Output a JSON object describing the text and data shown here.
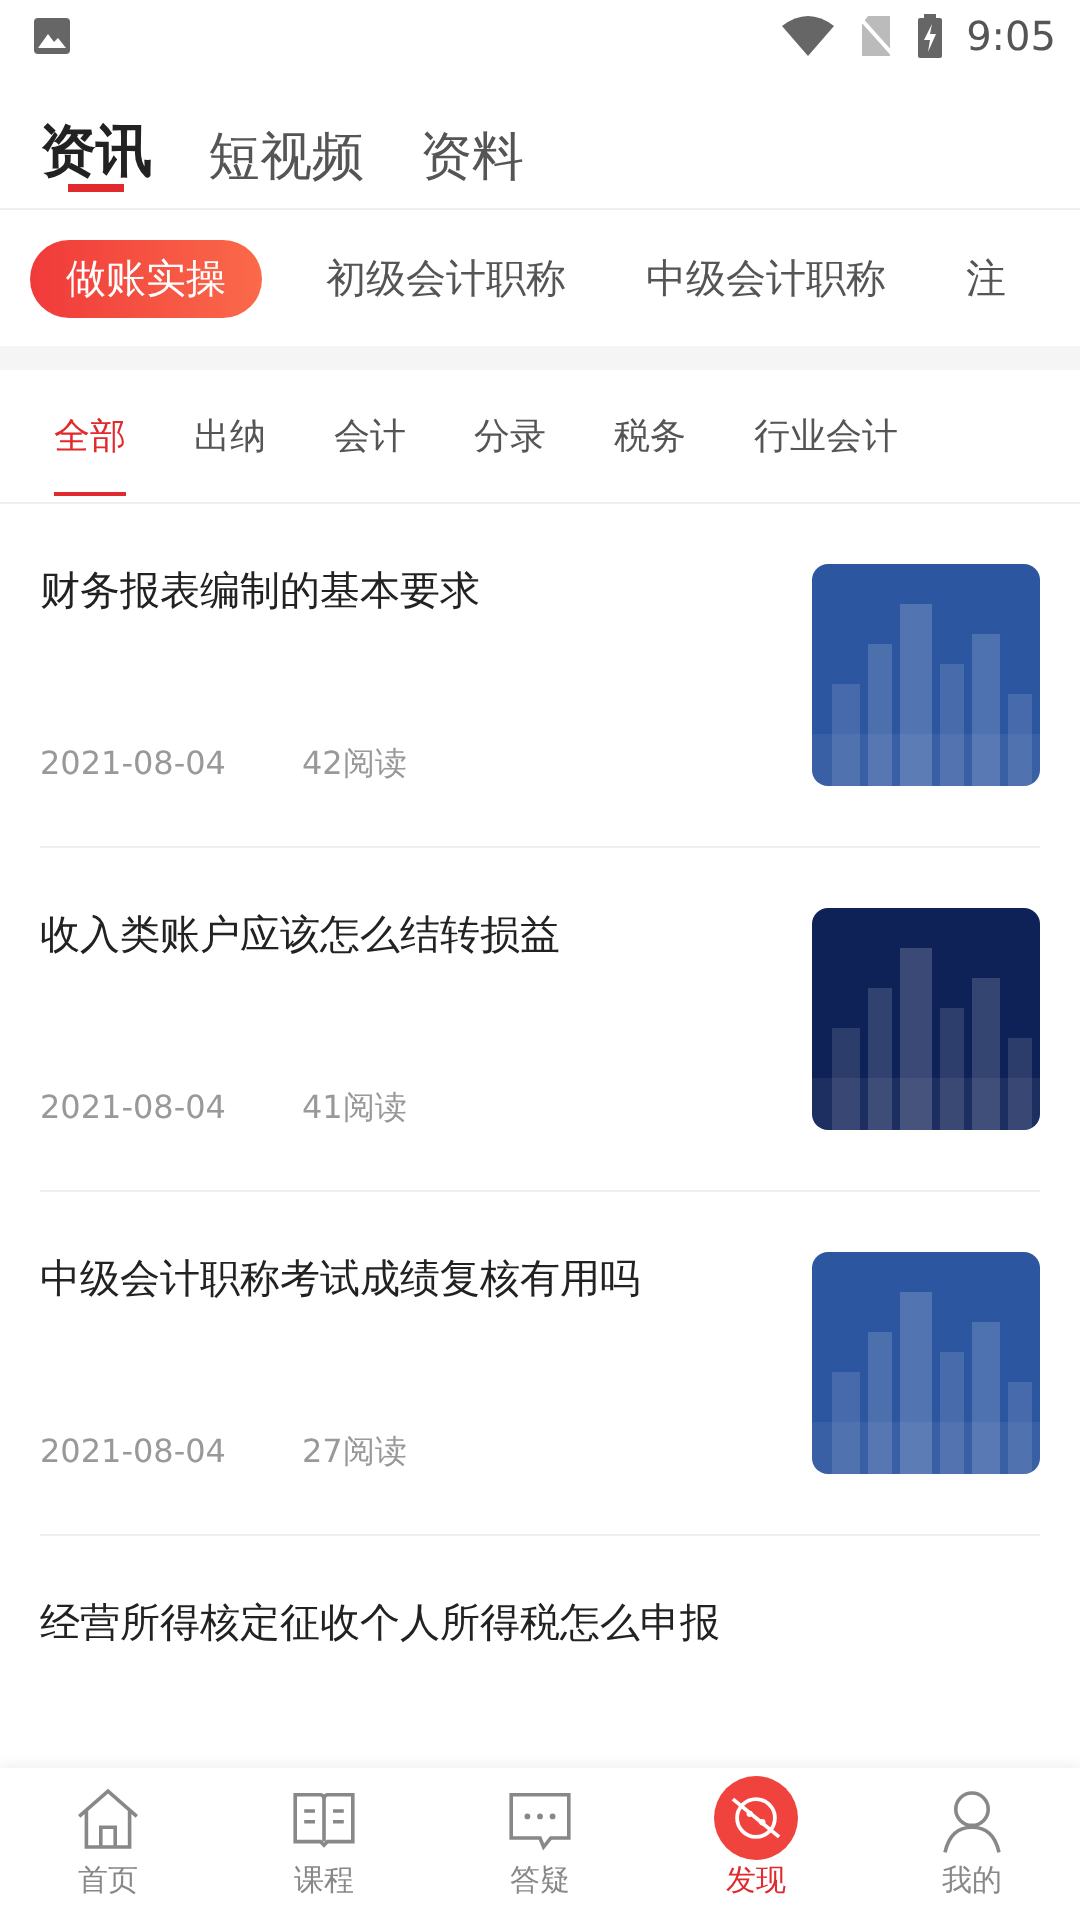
{
  "status_bar": {
    "time": "9:05"
  },
  "main_tabs": [
    {
      "label": "资讯",
      "selected": true
    },
    {
      "label": "短视频",
      "selected": false
    },
    {
      "label": "资料",
      "selected": false
    }
  ],
  "chips": [
    {
      "label": "做账实操",
      "selected": true
    },
    {
      "label": "初级会计职称",
      "selected": false
    },
    {
      "label": "中级会计职称",
      "selected": false
    },
    {
      "label": "注",
      "selected": false
    }
  ],
  "categories": [
    {
      "label": "全部",
      "selected": true
    },
    {
      "label": "出纳",
      "selected": false
    },
    {
      "label": "会计",
      "selected": false
    },
    {
      "label": "分录",
      "selected": false
    },
    {
      "label": "税务",
      "selected": false
    },
    {
      "label": "行业会计",
      "selected": false
    }
  ],
  "articles": [
    {
      "title": "财务报表编制的基本要求",
      "date": "2021-08-04",
      "reads": "42阅读"
    },
    {
      "title": "收入类账户应该怎么结转损益",
      "date": "2021-08-04",
      "reads": "41阅读"
    },
    {
      "title": "中级会计职称考试成绩复核有用吗",
      "date": "2021-08-04",
      "reads": "27阅读"
    },
    {
      "title": "经营所得核定征收个人所得税怎么申报"
    }
  ],
  "bottom_nav": [
    {
      "label": "首页",
      "kind": "home",
      "selected": false
    },
    {
      "label": "课程",
      "kind": "book",
      "selected": false
    },
    {
      "label": "答疑",
      "kind": "chat",
      "selected": false
    },
    {
      "label": "发现",
      "kind": "planet",
      "selected": true
    },
    {
      "label": "我的",
      "kind": "person",
      "selected": false
    }
  ]
}
